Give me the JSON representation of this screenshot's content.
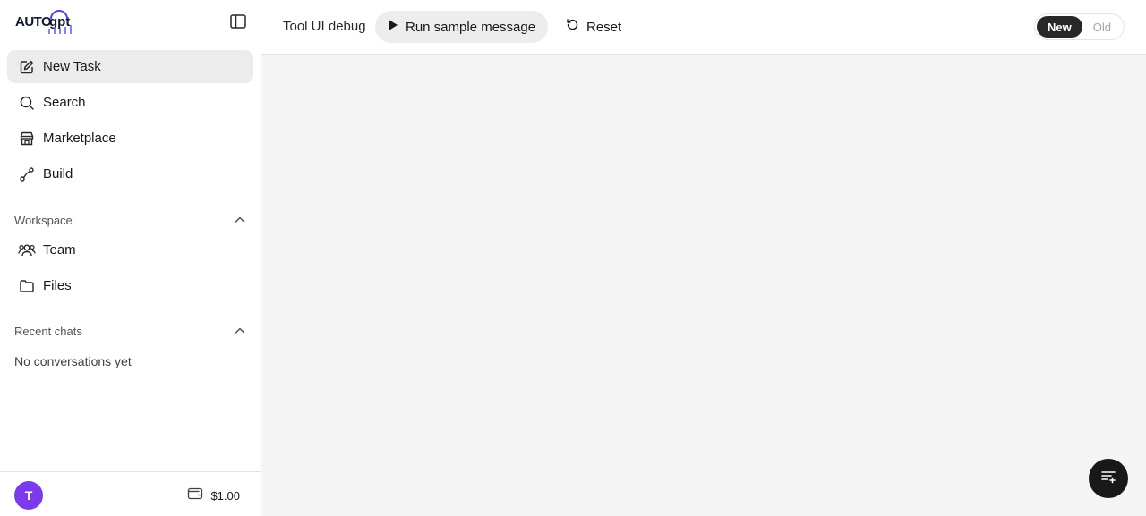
{
  "app": {
    "logo_text": "AUTOgpt"
  },
  "sidebar": {
    "nav": [
      {
        "label": "New Task",
        "icon": "edit-icon",
        "active": true
      },
      {
        "label": "Search",
        "icon": "search-icon"
      },
      {
        "label": "Marketplace",
        "icon": "store-icon"
      },
      {
        "label": "Build",
        "icon": "workflow-icon"
      }
    ],
    "workspace": {
      "title": "Workspace",
      "items": [
        {
          "label": "Team",
          "icon": "users-icon"
        },
        {
          "label": "Files",
          "icon": "folder-icon"
        }
      ]
    },
    "recent": {
      "title": "Recent chats",
      "empty": "No conversations yet"
    },
    "footer": {
      "avatar_initial": "T",
      "credits": "$1.00"
    }
  },
  "topbar": {
    "title": "Tool UI debug",
    "run_label": "Run sample message",
    "reset_label": "Reset",
    "toggle": {
      "new": "New",
      "old": "Old",
      "selected": "New"
    }
  },
  "colors": {
    "avatar": "#7c3aed",
    "active_nav": "#ececed",
    "toggle_on": "#27272a",
    "fab": "#18181b"
  }
}
